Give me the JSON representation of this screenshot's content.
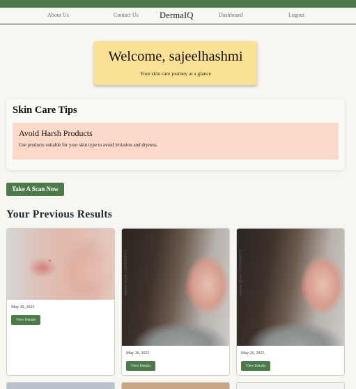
{
  "nav": {
    "about": "About Us",
    "contact": "Contact Us",
    "brand": "DermaIQ",
    "dashboard": "Dashboard",
    "logout": "Logout"
  },
  "welcome": {
    "title": "Welcome, sajeelhashmi",
    "subtitle": "Your skin care journey at a glance"
  },
  "tips": {
    "heading": "Skin Care Tips",
    "card_title": "Avoid Harsh Products",
    "card_text": "Use products suitable for your skin type to avoid irritation and dryness."
  },
  "scan_button": "Take A Scan Now",
  "results": {
    "heading": "Your Previous Results",
    "items": [
      {
        "date": "May 29, 2025",
        "button": "View Details"
      },
      {
        "date": "May 26, 2025",
        "button": "View Details",
        "watermark": "Adobe Stock | #915454777"
      },
      {
        "date": "May 26, 2025",
        "button": "View Details",
        "watermark": "Adobe Stock | #915454777"
      }
    ]
  },
  "colors": {
    "accent": "#4c7a4b",
    "welcome_bg": "#fbe196",
    "tip_bg": "#fcd9c8",
    "page_bg": "#f8f6f1"
  }
}
